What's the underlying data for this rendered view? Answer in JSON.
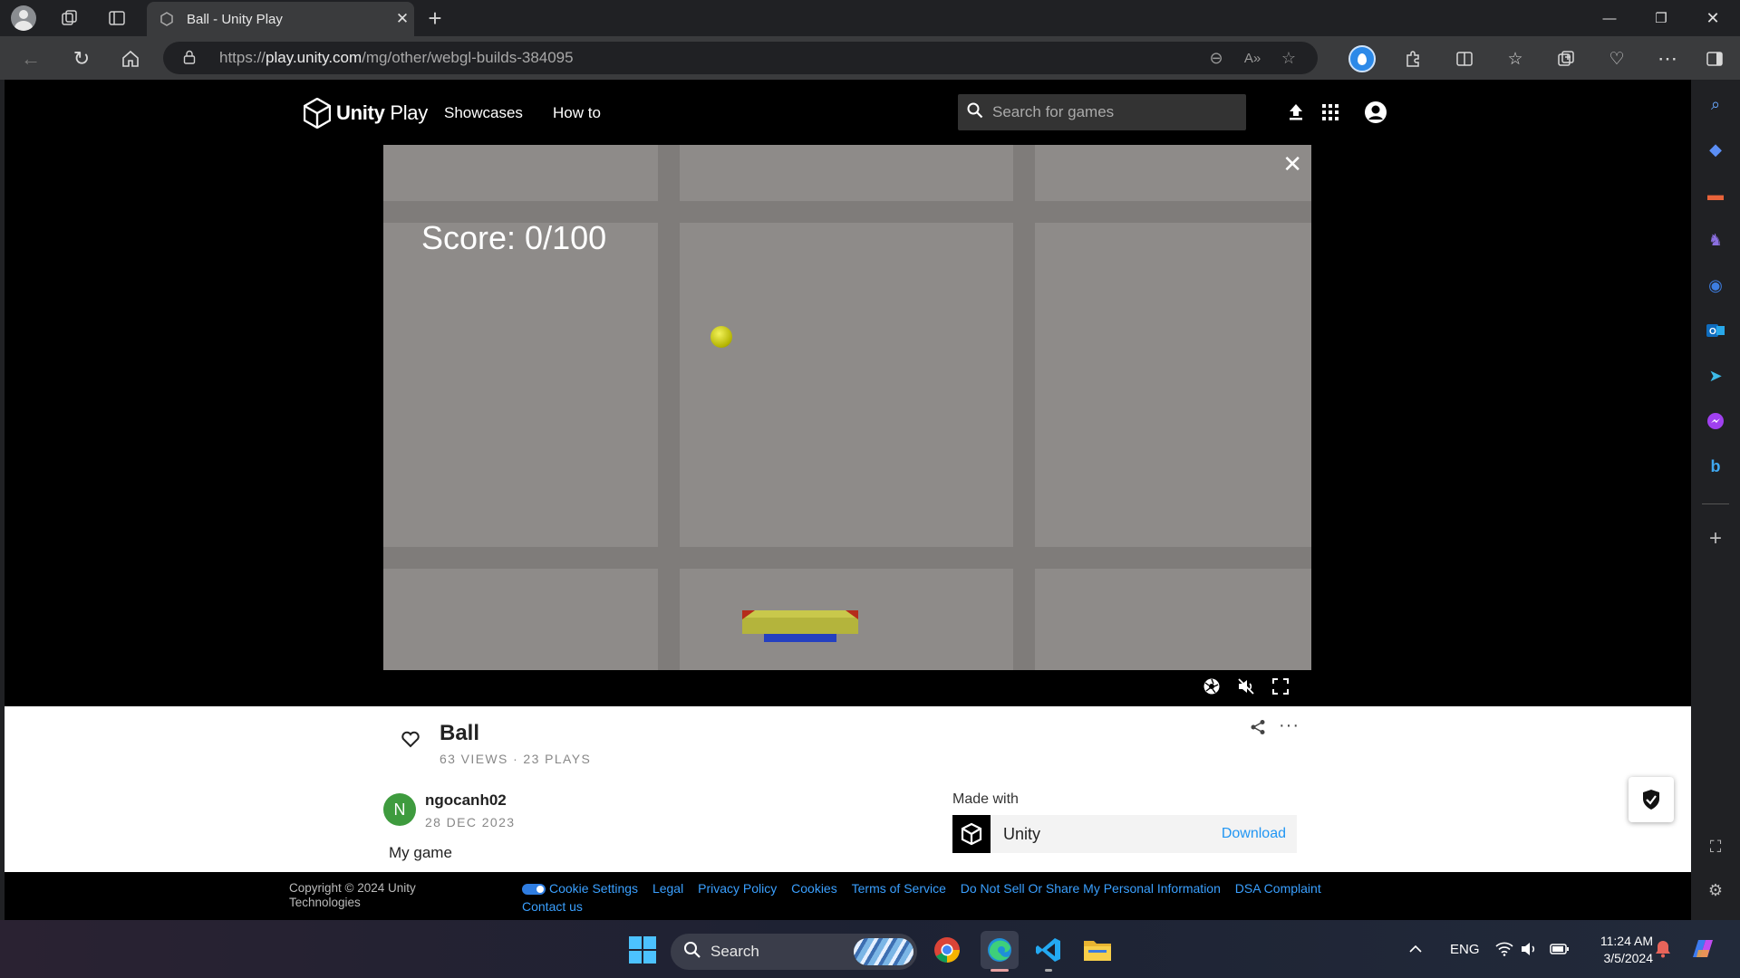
{
  "browser": {
    "tab_title": "Ball - Unity Play",
    "url_prefix": "https://",
    "url_host": "play.unity.com",
    "url_path": "/mg/other/webgl-builds-384095"
  },
  "site": {
    "logo_text_bold": "Unity",
    "logo_text": " Play",
    "nav": [
      "Showcases",
      "How to"
    ],
    "search_placeholder": "Search for games"
  },
  "game": {
    "score_text": "Score: 0/100"
  },
  "project": {
    "title": "Ball",
    "stats": "63 VIEWS · 23 PLAYS",
    "creator_initial": "N",
    "creator_name": "ngocanh02",
    "date": "28 DEC 2023",
    "description": "My game",
    "made_with_label": "Made with",
    "engine": "Unity",
    "download_label": "Download"
  },
  "footer": {
    "copyright": "Copyright © 2024 Unity Technologies",
    "links": [
      "Cookie Settings",
      "Legal",
      "Privacy Policy",
      "Cookies",
      "Terms of Service",
      "Do Not Sell Or Share My Personal Information",
      "DSA Complaint",
      "Contact us"
    ]
  },
  "taskbar": {
    "search_label": "Search",
    "language": "ENG",
    "time": "11:24 AM",
    "date": "3/5/2024"
  },
  "colors": {
    "link_blue": "#2196f3",
    "game_bg": "#8e8b89",
    "creator_avatar": "#3e9b3e",
    "paddle_yellow": "#b4b43c",
    "paddle_base_blue": "#2440c0"
  }
}
